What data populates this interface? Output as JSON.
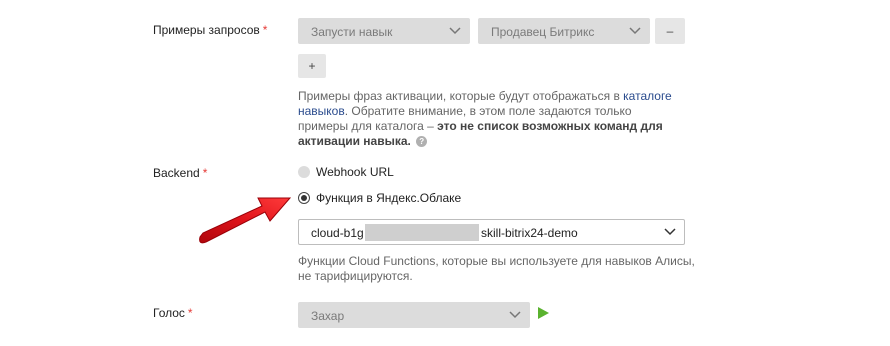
{
  "examples": {
    "label": "Примеры запросов",
    "required_mark": "*",
    "select1_value": "Запусти навык",
    "select2_value": "Продавец Битрикс",
    "remove_label": "–",
    "add_label": "+",
    "help_prefix": "Примеры фраз активации, которые будут отображаться в ",
    "help_link": "каталоге навыков",
    "help_middle": ". Обратите внимание, в этом поле задаются только примеры для каталога – ",
    "help_bold": "это не список возможных команд для активации навыка.",
    "help_icon": "?"
  },
  "backend": {
    "label": "Backend",
    "required_mark": "*",
    "options": [
      {
        "label": "Webhook URL",
        "selected": false
      },
      {
        "label": "Функция в Яндекс.Облаке",
        "selected": true
      }
    ],
    "function_prefix": "cloud-b1g",
    "function_suffix": "skill-bitrix24-demo",
    "help_line1": "Функции Cloud Functions, которые вы используете для навыков Алисы,",
    "help_line2": "не тарифицируются."
  },
  "voice": {
    "label": "Голос",
    "required_mark": "*",
    "value": "Захар"
  },
  "colors": {
    "arrow": "#e0141b",
    "play": "#5ab22f",
    "link": "#2a4b8d",
    "required": "#e53935"
  }
}
